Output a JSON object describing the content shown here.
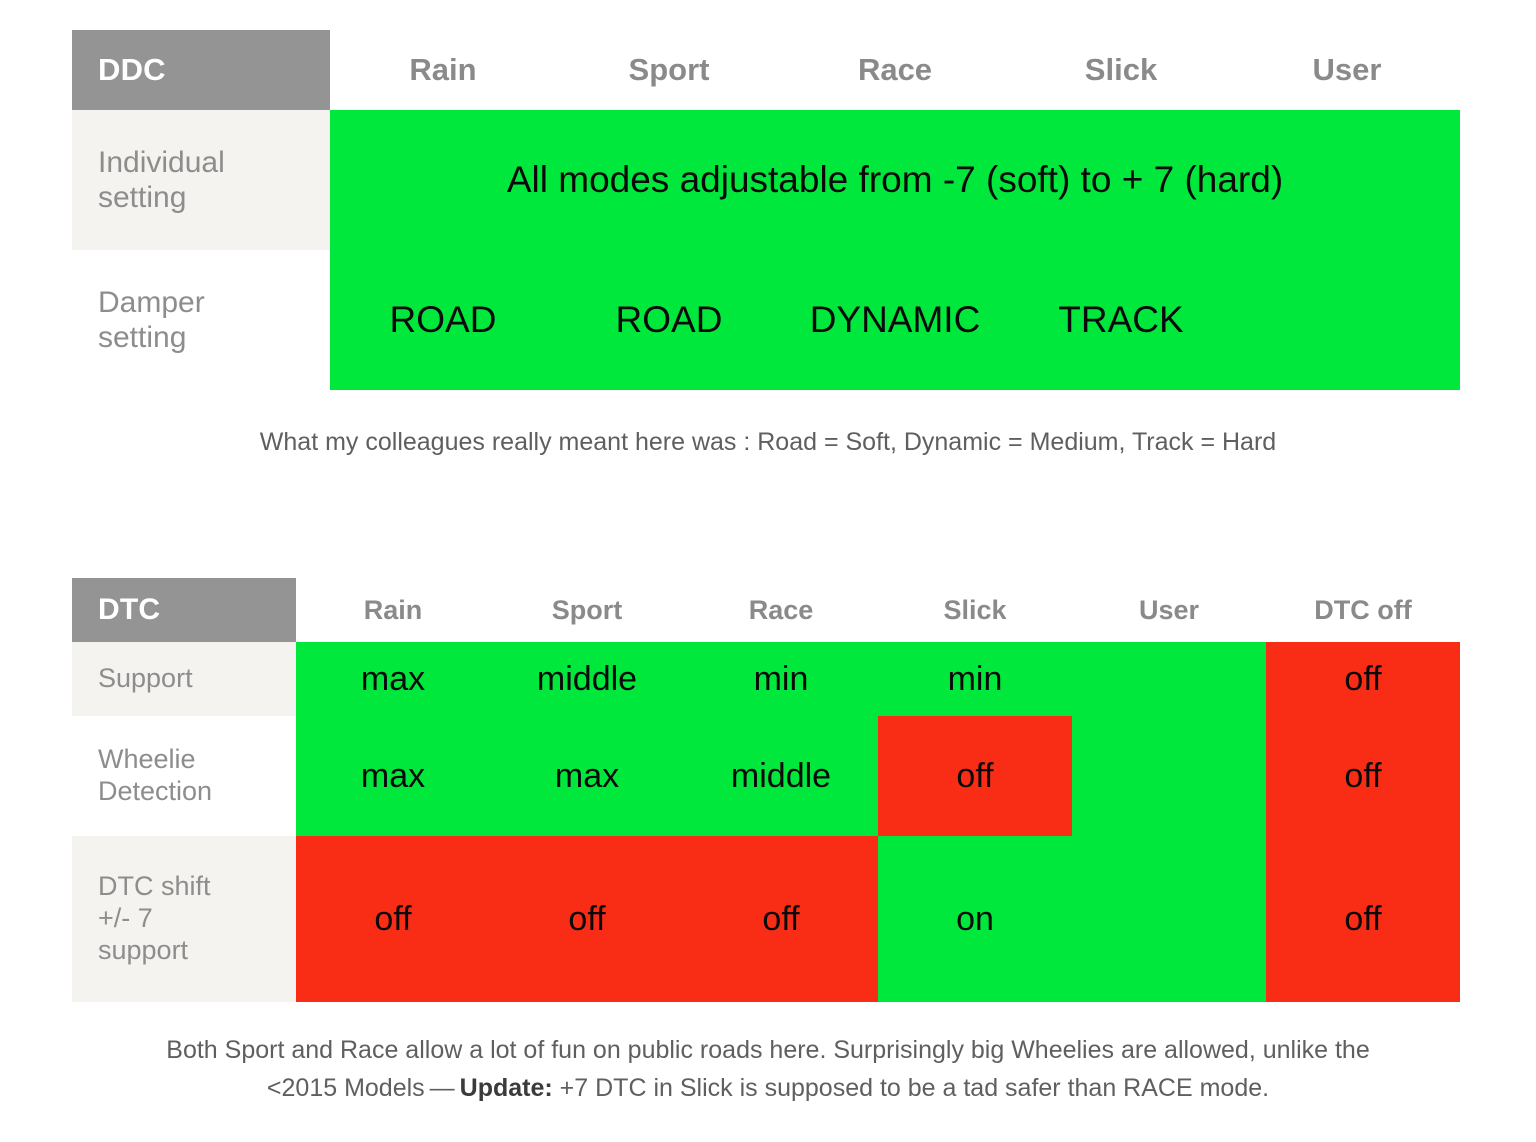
{
  "ddc_table": {
    "corner_label": "DDC",
    "columns": [
      "Rain",
      "Sport",
      "Race",
      "Slick",
      "User"
    ],
    "rows": [
      {
        "label": "Individual setting",
        "label_line1": "Individual",
        "label_line2": "setting",
        "span_text": "All modes adjustable from -7 (soft) to + 7 (hard)",
        "span_color": "#00e83c"
      },
      {
        "label": "Damper setting",
        "label_line1": "Damper",
        "label_line2": "setting",
        "values": [
          "ROAD",
          "ROAD",
          "DYNAMIC",
          "TRACK",
          ""
        ],
        "colors": [
          "#00e83c",
          "#00e83c",
          "#00e83c",
          "#00e83c",
          "#00e83c"
        ]
      }
    ]
  },
  "ddc_caption": "What my colleagues really meant here was : Road = Soft, Dynamic = Medium, Track = Hard",
  "dtc_table": {
    "corner_label": "DTC",
    "columns": [
      "Rain",
      "Sport",
      "Race",
      "Slick",
      "User",
      "DTC off"
    ],
    "rows": [
      {
        "label": "Support",
        "label_line1": "Support",
        "label_line2": "",
        "label_line3": "",
        "values": [
          "max",
          "middle",
          "min",
          "min",
          "",
          "off"
        ],
        "colors": [
          "#00e83c",
          "#00e83c",
          "#00e83c",
          "#00e83c",
          "#00e83c",
          "#f92d15"
        ]
      },
      {
        "label": "Wheelie Detection",
        "label_line1": "Wheelie",
        "label_line2": "Detection",
        "label_line3": "",
        "values": [
          "max",
          "max",
          "middle",
          "off",
          "",
          "off"
        ],
        "colors": [
          "#00e83c",
          "#00e83c",
          "#00e83c",
          "#f92d15",
          "#00e83c",
          "#f92d15"
        ]
      },
      {
        "label": "DTC shift +/- 7 support",
        "label_line1": "DTC shift",
        "label_line2": "+/- 7",
        "label_line3": "support",
        "values": [
          "off",
          "off",
          "off",
          "on",
          "",
          "off"
        ],
        "colors": [
          "#f92d15",
          "#f92d15",
          "#f92d15",
          "#00e83c",
          "#00e83c",
          "#f92d15"
        ]
      }
    ]
  },
  "dtc_caption": {
    "line1": "Both Sport and Race allow a lot of fun on public roads here. Surprisingly big Wheelies are allowed, unlike the",
    "line2_pre": "<2015 Models — ",
    "line2_bold": "Update:",
    "line2_post": " +7 DTC in Slick is supposed to be a tad safer than RACE mode."
  },
  "colors": {
    "green": "#00e83c",
    "red": "#f92d15",
    "header_gray": "#949494",
    "label_gray": "#8d8d8d",
    "shade": "#f4f3ef"
  }
}
